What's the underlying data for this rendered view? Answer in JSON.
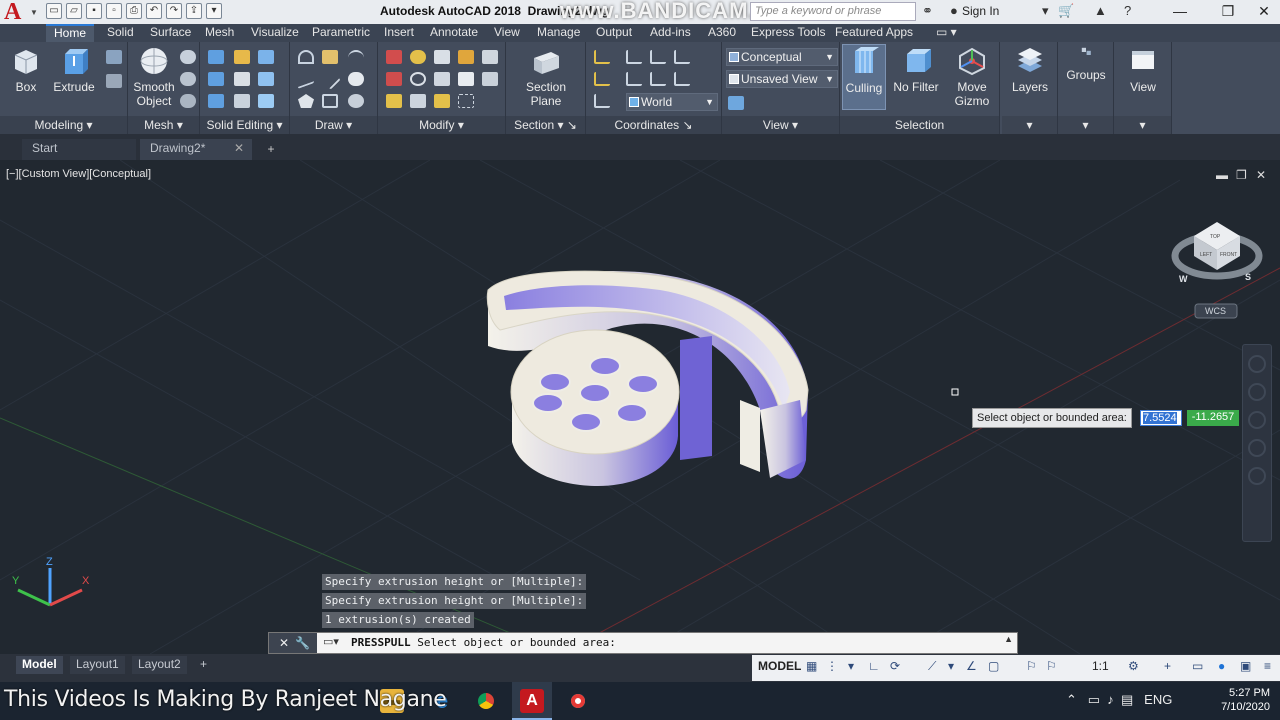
{
  "app": {
    "title": "Autodesk AutoCAD 2018",
    "title_file": "Drawing2.dwg",
    "watermark": "www.BANDICAM.com",
    "logo_letter": "A",
    "search_placeholder": "Type a keyword or phrase",
    "sign_in": "Sign In"
  },
  "ribbon_tabs": [
    "Home",
    "Solid",
    "Surface",
    "Mesh",
    "Visualize",
    "Parametric",
    "Insert",
    "Annotate",
    "View",
    "Manage",
    "Output",
    "Add-ins",
    "A360",
    "Express Tools",
    "Featured Apps"
  ],
  "ribbon": {
    "modeling": {
      "title": "Modeling",
      "box": "Box",
      "extrude": "Extrude"
    },
    "mesh": {
      "title": "Mesh",
      "smooth_object_1": "Smooth",
      "smooth_object_2": "Object"
    },
    "solid_editing": {
      "title": "Solid Editing"
    },
    "draw": {
      "title": "Draw"
    },
    "modify": {
      "title": "Modify"
    },
    "section": {
      "title": "Section",
      "section_plane_1": "Section",
      "section_plane_2": "Plane"
    },
    "coordinates": {
      "title": "Coordinates",
      "ucs": "World"
    },
    "view": {
      "title": "View",
      "visual_style": "Conceptual",
      "named_view": "Unsaved View"
    },
    "selection": {
      "title": "Selection",
      "culling": "Culling",
      "no_filter": "No Filter",
      "move_gizmo_1": "Move",
      "move_gizmo_2": "Gizmo"
    },
    "layers": "Layers",
    "groups": "Groups",
    "view_btn": "View"
  },
  "file_tabs": {
    "start": "Start",
    "drawing": "Drawing2*"
  },
  "viewport": {
    "label": "[−][Custom View][Conceptual]",
    "wcs": "WCS",
    "viewcube": {
      "top": "TOP",
      "left": "LEFT",
      "front": "FRONT",
      "w": "W",
      "s": "S"
    },
    "axis": {
      "z": "Z",
      "y": "Y",
      "x": "X"
    }
  },
  "dynamic_input": {
    "prompt": "Select object or bounded area:",
    "x_value": "7.5524",
    "y_value": "-11.2657"
  },
  "command": {
    "history": [
      "Specify extrusion height or [Multiple]:",
      "Specify extrusion height or [Multiple]:",
      "1 extrusion(s) created"
    ],
    "current_cmd": "PRESSPULL",
    "current_prompt": "Select object or bounded area:"
  },
  "layout_tabs": {
    "model": "Model",
    "layout1": "Layout1",
    "layout2": "Layout2"
  },
  "status": {
    "model": "MODEL",
    "scale": "1:1"
  },
  "taskbar": {
    "caption": "This Videos Is Making By Ranjeet Nagane",
    "lang": "ENG",
    "time": "5:27 PM",
    "date": "7/10/2020"
  },
  "colors": {
    "accent": "#2a7ad6",
    "viewport_bg": "#212830",
    "solid_light": "#eeeadf",
    "solid_shade": "#7f72d8"
  }
}
